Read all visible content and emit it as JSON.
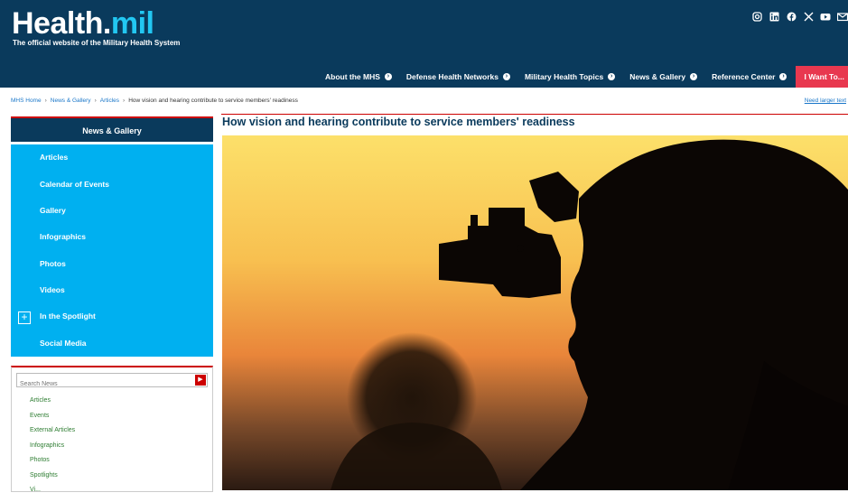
{
  "header": {
    "logo_main": "Health.",
    "logo_accent": "mil",
    "tagline": "The official website of the Military Health System",
    "social": [
      "instagram-icon",
      "linkedin-icon",
      "facebook-icon",
      "x-icon",
      "youtube-icon",
      "email-icon"
    ]
  },
  "nav": {
    "items": [
      {
        "label": "About the MHS"
      },
      {
        "label": "Defense Health Networks"
      },
      {
        "label": "Military Health Topics"
      },
      {
        "label": "News & Gallery"
      },
      {
        "label": "Reference Center"
      }
    ],
    "want": "I Want To..."
  },
  "breadcrumb": {
    "items": [
      "MHS Home",
      "News & Gallery",
      "Articles"
    ],
    "current": "How vision and hearing contribute to service members' readiness",
    "need_larger": "Need larger text"
  },
  "sidebar": {
    "title": "News & Gallery",
    "menu": [
      "Articles",
      "Calendar of Events",
      "Gallery",
      "Infographics",
      "Photos",
      "Videos",
      "In the Spotlight",
      "Social Media"
    ],
    "search_placeholder": "Search News",
    "filters": [
      "Articles",
      "Events",
      "External Articles",
      "Infographics",
      "Photos",
      "Spotlights",
      "Vi..."
    ]
  },
  "article": {
    "title": "How vision and hearing contribute to service members' readiness"
  },
  "colors": {
    "navy": "#0a3a5c",
    "cyan": "#00b0f0",
    "red": "#e8384f"
  }
}
